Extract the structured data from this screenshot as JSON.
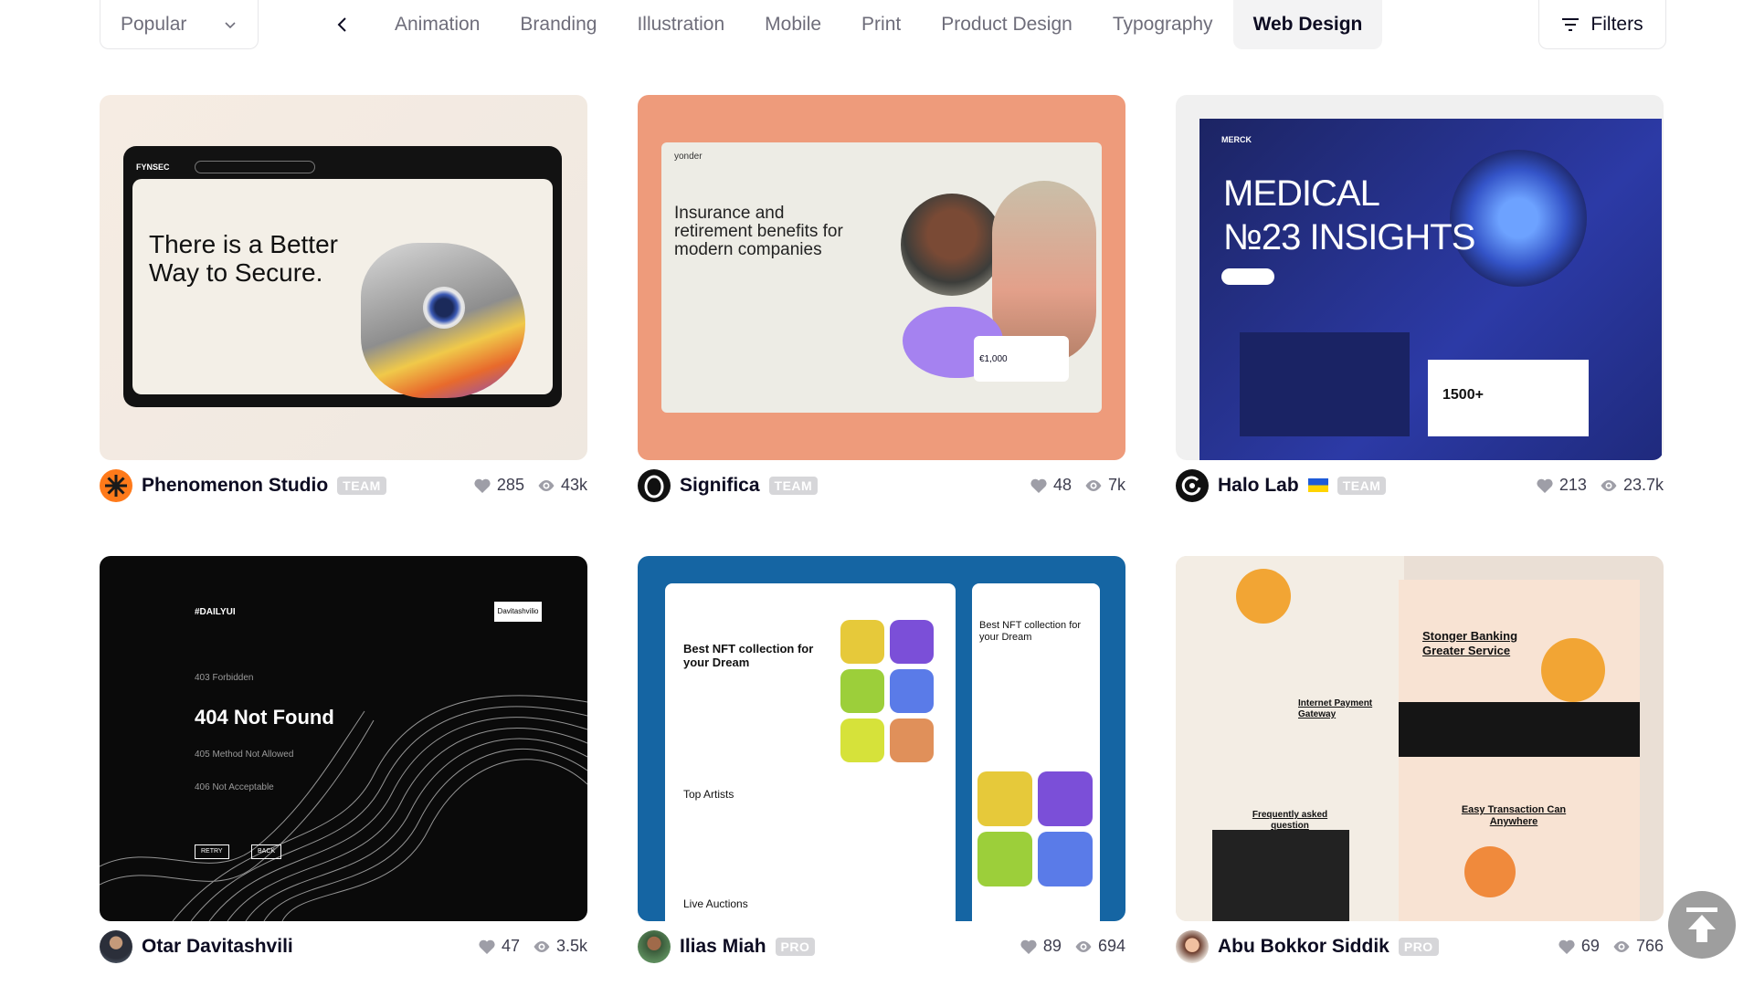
{
  "toolbar": {
    "sort_label": "Popular",
    "categories": [
      "Animation",
      "Branding",
      "Illustration",
      "Mobile",
      "Print",
      "Product Design",
      "Typography",
      "Web Design"
    ],
    "active_category": "Web Design",
    "filters_label": "Filters"
  },
  "shots": [
    {
      "author": "Phenomenon Studio",
      "badge": "TEAM",
      "likes": "285",
      "views": "43k",
      "thumb": {
        "brand": "FYNSEC",
        "headline": "There is a Better Way to Secure."
      }
    },
    {
      "author": "Significa",
      "badge": "TEAM",
      "likes": "48",
      "views": "7k",
      "thumb": {
        "brand": "yonder",
        "headline": "Insurance and retirement benefits for modern companies",
        "amount": "€1,000"
      }
    },
    {
      "author": "Halo Lab",
      "badge": "TEAM",
      "likes": "213",
      "views": "23.7k",
      "thumb": {
        "brand": "MERCK",
        "headline_1": "MEDICAL",
        "headline_2": "№23 INSIGHTS",
        "count": "1500+"
      }
    },
    {
      "author": "Otar Davitashvili",
      "badge": "",
      "likes": "47",
      "views": "3.5k",
      "thumb": {
        "brand": "#DAILYUI",
        "user": "Davitashvilio",
        "line_1": "403 Forbidden",
        "headline": "404 Not Found",
        "line_2": "405 Method Not Allowed",
        "line_3": "406 Not Acceptable",
        "btn_1": "RETRY",
        "btn_2": "BACK"
      }
    },
    {
      "author": "Ilias Miah",
      "badge": "PRO",
      "likes": "89",
      "views": "694",
      "thumb": {
        "headline": "Best NFT collection for your Dream",
        "headline_side": "Best NFT collection for your Dream",
        "section_1": "Top Artists",
        "section_2": "Live Auctions"
      }
    },
    {
      "author": "Abu Bokkor Siddik",
      "badge": "PRO",
      "likes": "69",
      "views": "766",
      "thumb": {
        "headline": "Stonger Banking Greater Service",
        "headline_2": "Easy Transaction Can Anywhere",
        "headline_3": "Internet Payment Gateway",
        "headline_4": "Frequently asked question"
      }
    }
  ],
  "colors": {
    "accent": "#0d0c22",
    "muted": "#6e6d7a",
    "badge": "#d6d6d9",
    "fab": "#9e9e9e"
  }
}
